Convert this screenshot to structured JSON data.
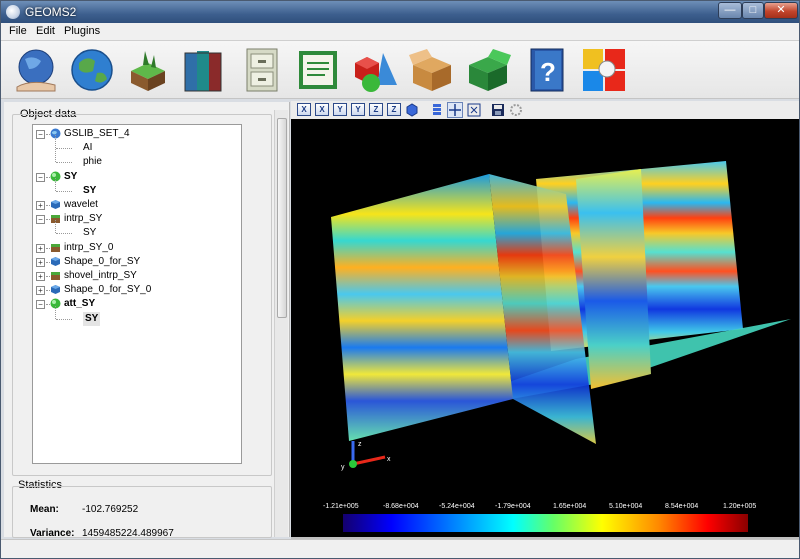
{
  "window": {
    "title": "GEOMS2",
    "minimize": "—",
    "maximize": "□",
    "close": "✕"
  },
  "menu": [
    "File",
    "Edit",
    "Plugins"
  ],
  "toolbar_tools": [
    "hand-globe-icon",
    "globe-icon",
    "terrain-block-icon",
    "books-icon",
    "cabinet-icon",
    "report-icon",
    "shapes-icon",
    "open-box-icon",
    "green-box-icon",
    "help-book-icon",
    "plugins-tiles-icon"
  ],
  "object_data": {
    "title": "Object data",
    "tree": [
      {
        "label": "GSLIB_SET_4",
        "bold": false,
        "level": 0,
        "icon": "globe-icon",
        "expander": "−"
      },
      {
        "label": "AI",
        "bold": false,
        "level": 1
      },
      {
        "label": "phie",
        "bold": false,
        "level": 1
      },
      {
        "label": "SY",
        "bold": true,
        "level": 0,
        "icon": "green-sphere-icon",
        "expander": "−"
      },
      {
        "label": "SY",
        "bold": true,
        "level": 1
      },
      {
        "label": "wavelet",
        "bold": false,
        "level": 0,
        "icon": "cube-icon",
        "expander": "+"
      },
      {
        "label": "intrp_SY",
        "bold": false,
        "level": 0,
        "icon": "terrain-icon",
        "expander": "−"
      },
      {
        "label": "SY",
        "bold": false,
        "level": 1
      },
      {
        "label": "intrp_SY_0",
        "bold": false,
        "level": 0,
        "icon": "terrain-icon",
        "expander": "+"
      },
      {
        "label": "Shape_0_for_SY",
        "bold": false,
        "level": 0,
        "icon": "cube-icon",
        "expander": "+"
      },
      {
        "label": "shovel_intrp_SY",
        "bold": false,
        "level": 0,
        "icon": "terrain-icon",
        "expander": "+"
      },
      {
        "label": "Shape_0_for_SY_0",
        "bold": false,
        "level": 0,
        "icon": "cube-icon",
        "expander": "+"
      },
      {
        "label": "att_SY",
        "bold": true,
        "level": 0,
        "icon": "green-sphere-icon",
        "expander": "−"
      },
      {
        "label": "SY",
        "bold": true,
        "level": 1,
        "selected": true
      }
    ]
  },
  "statistics": {
    "title": "Statistics",
    "mean_label": "Mean:",
    "mean_value": "-102.769252",
    "variance_label": "Variance:",
    "variance_value": "1459485224.489967"
  },
  "view_toolbar": [
    "X",
    "X",
    "Y",
    "Y",
    "Z",
    "Z"
  ],
  "colorbar": {
    "labels": [
      "-1.21e+005",
      "-8.68e+004",
      "-5.24e+004",
      "-1.79e+004",
      "1.65e+004",
      "5.10e+004",
      "8.54e+004",
      "1.20e+005"
    ]
  },
  "axes": {
    "x": "x",
    "y": "y",
    "z": "z"
  }
}
